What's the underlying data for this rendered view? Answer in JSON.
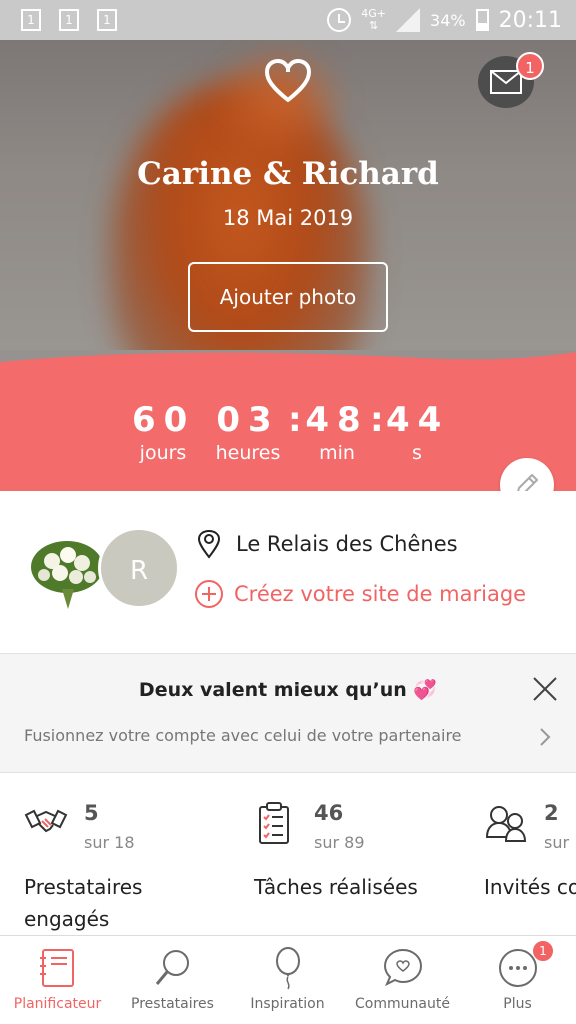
{
  "status_bar": {
    "notif_icons": [
      "1",
      "1",
      "1"
    ],
    "network": "4G+",
    "battery": "34%",
    "time": "20:11"
  },
  "header": {
    "couple_names": "Carine & Richard",
    "wedding_date": "18 Mai 2019",
    "add_photo_label": "Ajouter photo",
    "inbox_badge": "1"
  },
  "countdown": {
    "days": "60",
    "days_label": "jours",
    "hours": "03",
    "hours_label": "heures",
    "minutes": "48",
    "minutes_label": "min",
    "seconds": "44",
    "seconds_label": "s"
  },
  "venue": {
    "avatar_initial": "R",
    "name": "Le Relais des Chênes",
    "create_site_label": "Créez votre site de mariage"
  },
  "merge_banner": {
    "title": "Deux valent mieux qu’un 💞",
    "subtitle": "Fusionnez votre compte avec celui de votre partenaire"
  },
  "stats": [
    {
      "count": "5",
      "total": "sur 18",
      "label": "Prestataires engagés"
    },
    {
      "count": "46",
      "total": "sur 89",
      "label": "Tâches réalisées"
    },
    {
      "count": "2",
      "total": "sur",
      "label": "Invités confirmés"
    }
  ],
  "nav": {
    "items": [
      {
        "label": "Planificateur",
        "icon": "planner-icon"
      },
      {
        "label": "Prestataires",
        "icon": "search-icon"
      },
      {
        "label": "Inspiration",
        "icon": "balloon-icon"
      },
      {
        "label": "Communauté",
        "icon": "chat-heart-icon"
      },
      {
        "label": "Plus",
        "icon": "more-icon"
      }
    ],
    "more_badge": "1"
  },
  "colors": {
    "accent": "#f36b6b",
    "status_bar": "#c9c9c9",
    "text": "#222222"
  }
}
